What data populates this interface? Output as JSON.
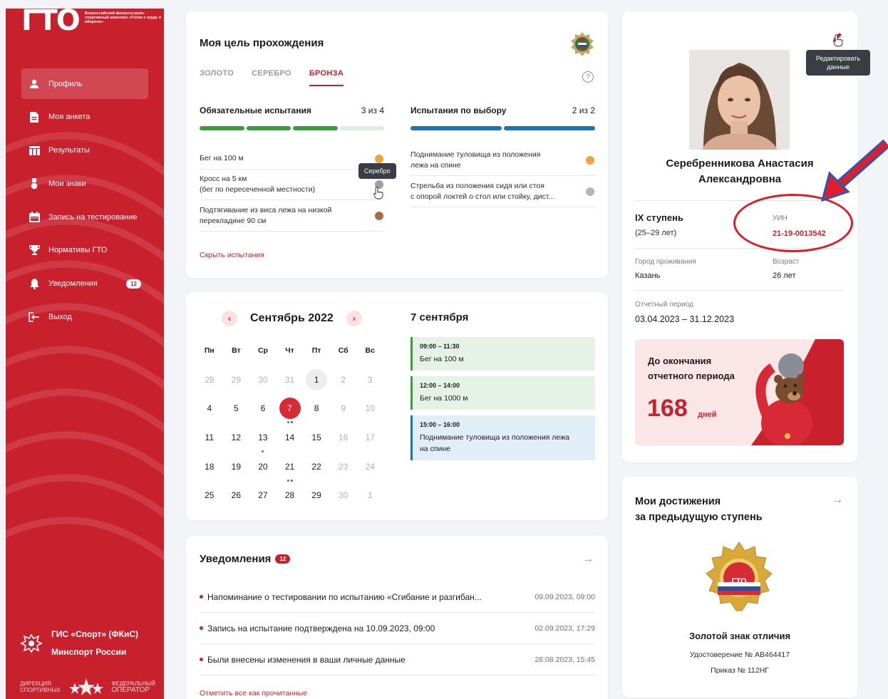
{
  "sidebar": {
    "logo_mark": "ГТО",
    "logo_text": "Всероссийский физкультурно-спортивный комплекс «Готов к труду и обороне»",
    "items": [
      {
        "label": "Профиль",
        "icon": "user-icon",
        "active": true
      },
      {
        "label": "Моя анкета",
        "icon": "document-icon"
      },
      {
        "label": "Результаты",
        "icon": "table-icon"
      },
      {
        "label": "Мои знаки",
        "icon": "medal-icon"
      },
      {
        "label": "Запись на тестирование",
        "icon": "calendar-icon"
      },
      {
        "label": "Нормативы ГТО",
        "icon": "trophy-icon"
      },
      {
        "label": "Уведомления",
        "icon": "bell-icon",
        "badge": "12"
      },
      {
        "label": "Выход",
        "icon": "logout-icon"
      }
    ],
    "gis_line1": "ГИС «Спорт» (ФКиС)",
    "gis_line2": "Минспорт России",
    "dir_line1": "ДИРЕКЦИЯ",
    "dir_line2": "СПОРТИВНЫХ",
    "op_line1": "ФЕДЕРАЛЬНЫЙ",
    "op_line2": "ОПЕРАТОР"
  },
  "goal": {
    "title": "Моя цель прохождения",
    "tabs": [
      "ЗОЛОТО",
      "СЕРЕБРО",
      "БРОНЗА"
    ],
    "active_tab": 2,
    "mandatory": {
      "title": "Обязательные испытания",
      "count": "3 из 4",
      "progress": [
        1,
        1,
        1,
        0
      ],
      "tests": [
        {
          "lines": [
            "Бег на 100 м"
          ],
          "color": "#f2a23a"
        },
        {
          "lines": [
            "Кросс на 5 км",
            "(бег по пересеченной местности)"
          ],
          "color": "#9e9ea6"
        },
        {
          "lines": [
            "Подтягивание из виса лежа на низкой",
            "перекладине 90 см"
          ],
          "color": "#a86a45"
        }
      ]
    },
    "optional": {
      "title": "Испытания по выбору",
      "count": "2 из 2",
      "progress": [
        1,
        1
      ],
      "tests": [
        {
          "lines": [
            "Поднимание туловища из положения",
            "лежа на спине"
          ],
          "color": "#f2a23a"
        },
        {
          "lines": [
            "Стрельба из положения сидя или стоя",
            "с опорой локтей о стол или стойку, дист..."
          ],
          "color": "#b4b4bb"
        }
      ]
    },
    "tooltip": "Серебро",
    "hide_label": "Скрыть испытания",
    "colors": {
      "green": "#3d9b3f",
      "green_light": "#dcefdc",
      "blue": "#1a73b5"
    }
  },
  "calendar": {
    "month": "Сентябрь 2022",
    "weekdays": [
      "Пн",
      "Вт",
      "Ср",
      "Чт",
      "Пт",
      "Сб",
      "Вс"
    ],
    "weeks": [
      [
        {
          "d": "28",
          "m": 1
        },
        {
          "d": "29",
          "m": 1
        },
        {
          "d": "30",
          "m": 1
        },
        {
          "d": "31",
          "m": 1
        },
        {
          "d": "1",
          "hl": "grey"
        },
        {
          "d": "2",
          "m": 1
        },
        {
          "d": "3",
          "m": 1
        }
      ],
      [
        {
          "d": "4"
        },
        {
          "d": "5"
        },
        {
          "d": "6"
        },
        {
          "d": "7",
          "hl": "red",
          "marks": [
            "#3d9b3f",
            "#1a73b5"
          ]
        },
        {
          "d": "8"
        },
        {
          "d": "9",
          "m": 1
        },
        {
          "d": "10",
          "m": 1
        }
      ],
      [
        {
          "d": "11"
        },
        {
          "d": "12"
        },
        {
          "d": "13",
          "marks": [
            "#3d9b3f"
          ]
        },
        {
          "d": "14"
        },
        {
          "d": "15"
        },
        {
          "d": "16",
          "m": 1
        },
        {
          "d": "17",
          "m": 1
        }
      ],
      [
        {
          "d": "18"
        },
        {
          "d": "19"
        },
        {
          "d": "20"
        },
        {
          "d": "21",
          "marks": [
            "#3d9b3f",
            "#1a73b5"
          ]
        },
        {
          "d": "22"
        },
        {
          "d": "23",
          "m": 1
        },
        {
          "d": "24",
          "m": 1
        }
      ],
      [
        {
          "d": "25"
        },
        {
          "d": "26"
        },
        {
          "d": "27"
        },
        {
          "d": "28"
        },
        {
          "d": "29"
        },
        {
          "d": "30",
          "m": 1
        },
        {
          "d": "1",
          "m": 1
        }
      ]
    ],
    "day_title": "7 сентября",
    "events": [
      {
        "time": "09:00 – 11:30",
        "name": [
          "Бег на 100 м"
        ],
        "bg": "#e5f2e5",
        "border": "#3d9b3f"
      },
      {
        "time": "12:00 – 14:00",
        "name": [
          "Бег на 1000 м"
        ],
        "bg": "#e5f2e5",
        "border": "#3d9b3f"
      },
      {
        "time": "15:00 – 16:00",
        "name": [
          "Поднимание туловища из положения лежа",
          "на спине"
        ],
        "bg": "#e1edf7",
        "border": "#1a73b5"
      }
    ]
  },
  "notifications": {
    "title": "Уведомления",
    "count": "12",
    "items": [
      {
        "text": "Напоминание о тестировании по испытанию «Сгибание и разгибан...",
        "time": "09.09.2023, 09:00"
      },
      {
        "text": "Запись на испытание подтверждена на 10.09.2023, 09:00",
        "time": "02.09.2023, 17:29"
      },
      {
        "text": "Были внесены изменения в ваши личные данные",
        "time": "28.08.2023, 15:45"
      }
    ],
    "mark_all": "Отметить все как прочитанные"
  },
  "profile": {
    "tooltip_line1": "Редактировать",
    "tooltip_line2": "данные",
    "name_line1": "Серебренникова Анастасия",
    "name_line2": "Александровна",
    "stage": "IX ступень",
    "stage_age": "(25–29 лет)",
    "uin_label": "УИН",
    "uin": "21-19-0013542",
    "city_label": "Город проживания",
    "city": "Казань",
    "age_label": "Возраст",
    "age": "26 лет",
    "period_label": "Отчетный период",
    "period": "03.04.2023 – 31.12.2023",
    "remain_line1": "До окончания",
    "remain_line2": "отчетного периода",
    "remain_days": "168",
    "remain_unit": "дней"
  },
  "achievements": {
    "title_line1": "Мои достижения",
    "title_line2": "за предыдущую ступень",
    "badge_text": "ГТО",
    "badge_title": "Золотой знак отличия",
    "certificate": "Удостоверение № АВ464417",
    "order": "Приказ № 112НГ"
  }
}
